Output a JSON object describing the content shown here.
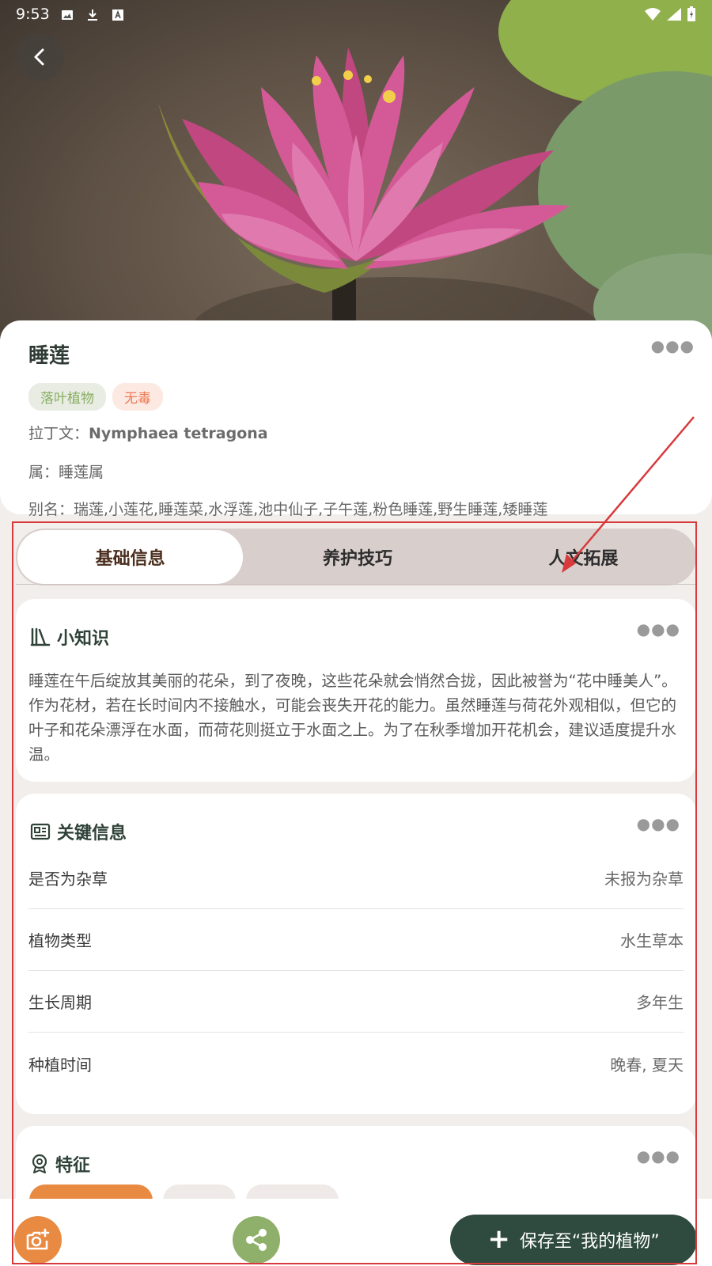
{
  "status_bar": {
    "time": "9:53"
  },
  "plant": {
    "name": "睡莲",
    "tags": [
      {
        "label": "落叶植物",
        "color": "#8aae64"
      },
      {
        "label": "无毒",
        "color": "#ef7b57"
      }
    ],
    "latin_label": "拉丁文：",
    "latin_value": "Nymphaea tetragona",
    "genus": "属：睡莲属",
    "aliases": "别名：瑞莲,小莲花,睡莲菜,水浮莲,池中仙子,子午莲,粉色睡莲,野生睡莲,矮睡莲"
  },
  "tabs": [
    {
      "label": "基础信息",
      "active": true
    },
    {
      "label": "养护技巧",
      "active": false
    },
    {
      "label": "人文拓展",
      "active": false
    }
  ],
  "knowledge": {
    "title": "小知识",
    "icon": "books-icon",
    "text": "睡莲在午后绽放其美丽的花朵，到了夜晚，这些花朵就会悄然合拢，因此被誉为“花中睡美人”。作为花材，若在长时间内不接触水，可能会丧失开花的能力。虽然睡莲与荷花外观相似，但它的叶子和花朵漂浮在水面，而荷花则挺立于水面之上。为了在秋季增加开花机会，建议适度提升水温。"
  },
  "key_info": {
    "title": "关键信息",
    "icon": "id-card-icon",
    "rows": [
      {
        "key": "是否为杂草",
        "value": "未报为杂草"
      },
      {
        "key": "植物类型",
        "value": "水生草本"
      },
      {
        "key": "生长周期",
        "value": "多年生"
      },
      {
        "key": "种植时间",
        "value": "晚春, 夏天"
      }
    ]
  },
  "features": {
    "title": "特征",
    "icon": "badge-icon"
  },
  "bottom": {
    "save_label": "保存至“我的植物”",
    "camera_icon": "camera-add-icon",
    "share_icon": "share-icon"
  },
  "colors": {
    "accent_dark": "#2f4a3e",
    "orange": "#e98a42",
    "green": "#8eb06b",
    "highlight": "#d8393c"
  }
}
